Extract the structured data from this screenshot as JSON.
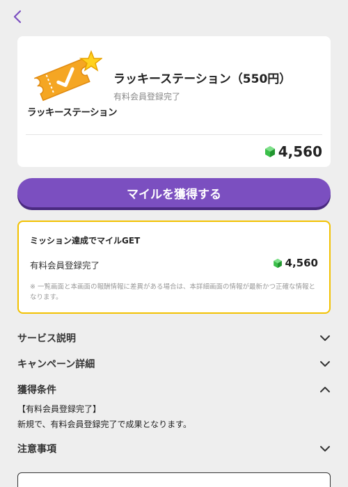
{
  "nav": {
    "back_icon": "chevron-left-icon"
  },
  "service": {
    "logo_text": "ラッキーステーション",
    "title": "ラッキーステーション（550円）",
    "subtitle": "有料会員登録完了",
    "reward": "4,560",
    "reward_icon": "green-gem-icon"
  },
  "get_button": {
    "label": "マイルを獲得する"
  },
  "mission": {
    "title": "ミッション達成でマイルGET",
    "row_label": "有料会員登録完了",
    "row_reward": "4,560",
    "note": "※ 一覧画面と本画面の報酬情報に差異がある場合は、本詳細画面の情報が最新かつ正確な情報となります。"
  },
  "sections": {
    "service_desc": "サービス説明",
    "campaign_detail": "キャンペーン詳細",
    "conditions": "獲得条件",
    "notes": "注意事項"
  },
  "conditions": {
    "line1": "【有料会員登録完了】",
    "line2": "新規で、有料会員登録完了で成果となります。"
  },
  "colors": {
    "accent": "#7b4fc0",
    "mission_border": "#f2c100",
    "logo_orange": "#f5a623",
    "gem_green": "#3bbf4a"
  }
}
